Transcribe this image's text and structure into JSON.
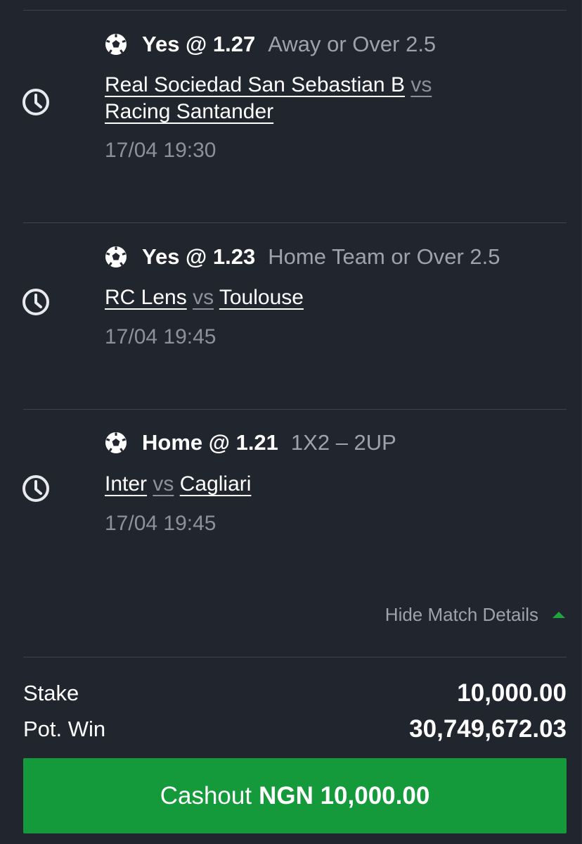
{
  "bets": [
    {
      "pick": "Yes @ 1.27",
      "market": "Away or Over 2.5",
      "home_team": "Real Sociedad San Sebastian B",
      "vs": "vs",
      "away_team": "Racing Santander",
      "datetime": "17/04 19:30"
    },
    {
      "pick": "Yes @ 1.23",
      "market": "Home Team or Over 2.5",
      "home_team": "RC Lens",
      "vs": "vs",
      "away_team": "Toulouse",
      "datetime": "17/04 19:45"
    },
    {
      "pick": "Home @ 1.21",
      "market": "1X2 – 2UP",
      "home_team": "Inter",
      "vs": "vs",
      "away_team": "Cagliari",
      "datetime": "17/04 19:45"
    }
  ],
  "details_toggle": {
    "label": "Hide Match Details",
    "icon": "caret-up-icon"
  },
  "summary": {
    "stake_label": "Stake",
    "stake_value": "10,000.00",
    "pot_win_label": "Pot. Win",
    "pot_win_value": "30,749,672.03"
  },
  "cashout": {
    "prefix": "Cashout",
    "amount": "NGN 10,000.00"
  },
  "colors": {
    "background": "#21252e",
    "accent_green": "#149a3a",
    "muted_text": "#9da2ab",
    "divider": "#3f4450"
  }
}
